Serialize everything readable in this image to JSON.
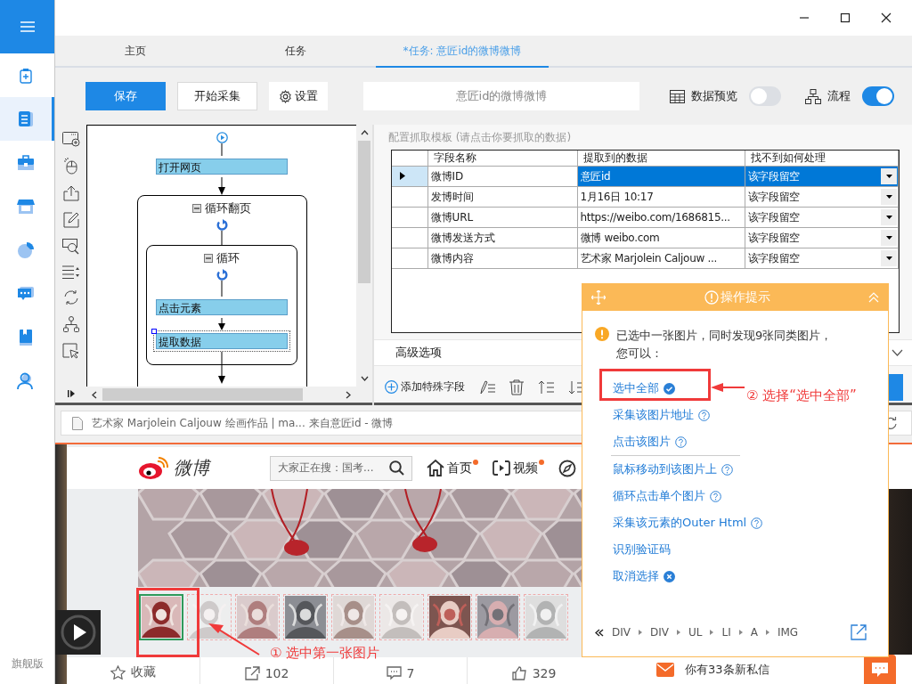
{
  "sidebar": {
    "items": [
      {
        "selected": false
      },
      {
        "selected": true
      },
      {
        "selected": false
      },
      {
        "selected": false
      },
      {
        "selected": false
      },
      {
        "selected": false
      },
      {
        "selected": false
      },
      {
        "selected": false
      }
    ],
    "edition": "旗舰版"
  },
  "tabs": [
    {
      "label": "主页",
      "selected": false
    },
    {
      "label": "任务",
      "selected": false
    },
    {
      "label": "*任务: 意匠id的微博微博",
      "selected": true
    }
  ],
  "toolbar": {
    "save": "保存",
    "start": "开始采集",
    "settings": "设置",
    "task_name": "意匠id的微博微博",
    "preview": {
      "label": "数据预览",
      "on": false
    },
    "flow": {
      "label": "流程",
      "on": true
    }
  },
  "flow": {
    "steps": [
      {
        "kind": "action",
        "label": "打开网页",
        "selected": false
      },
      {
        "kind": "loop",
        "label": "循环翻页",
        "expanded": true,
        "children": [
          {
            "kind": "loop",
            "label": "循环",
            "expanded": true,
            "children": [
              {
                "kind": "action",
                "label": "点击元素",
                "selected": false
              },
              {
                "kind": "action",
                "label": "提取数据",
                "selected": true
              }
            ]
          }
        ]
      }
    ]
  },
  "config": {
    "title": "配置抓取模板 (请点击你要抓取的数据)",
    "columns": [
      "字段名称",
      "提取到的数据",
      "找不到如何处理"
    ],
    "rows": [
      {
        "name": "微博ID",
        "value": "意匠id",
        "fallback": "该字段留空",
        "selected": true
      },
      {
        "name": "发博时间",
        "value": "1月16日 10:17",
        "fallback": "该字段留空",
        "selected": false
      },
      {
        "name": "微博URL",
        "value": "https://weibo.com/1686815...",
        "fallback": "该字段留空",
        "selected": false
      },
      {
        "name": "微博发送方式",
        "value": "微博 weibo.com",
        "fallback": "该字段留空",
        "selected": false
      },
      {
        "name": "微博内容",
        "value": "艺术家 Marjolein Caljouw ...",
        "fallback": "该字段留空",
        "selected": false
      }
    ],
    "advanced": "高级选项",
    "add_field": "添加特殊字段"
  },
  "browser": {
    "page_title": "艺术家 Marjolein Caljouw 绘画作品 | ma... 来自意匠id - 微博",
    "logo": "微博",
    "search_placeholder": "大家正在搜：国考...",
    "nav": [
      {
        "label": "首页",
        "badge": true
      },
      {
        "label": "视频",
        "badge": true
      }
    ],
    "thumbnails": [
      {
        "selected": true
      },
      {
        "selected": false
      },
      {
        "selected": false
      },
      {
        "selected": false
      },
      {
        "selected": false
      },
      {
        "selected": false
      },
      {
        "selected": false
      },
      {
        "selected": false
      },
      {
        "selected": false
      }
    ],
    "actions": [
      {
        "kind": "star",
        "label": "收藏"
      },
      {
        "kind": "share",
        "label": "102"
      },
      {
        "kind": "comment",
        "label": "7"
      },
      {
        "kind": "like",
        "label": "329"
      }
    ],
    "message": "你有33条新私信"
  },
  "tip": {
    "title": "操作提示",
    "message": "已选中一张图片，同时发现9张同类图片，您可以：",
    "options": [
      {
        "label": "选中全部",
        "kind": "check",
        "divider_before": false
      },
      {
        "label": "采集该图片地址",
        "kind": "help",
        "divider_before": false
      },
      {
        "label": "点击该图片",
        "kind": "help",
        "divider_before": false
      },
      {
        "label": "鼠标移动到该图片上",
        "kind": "help",
        "divider_before": true
      },
      {
        "label": "循环点击单个图片",
        "kind": "help",
        "divider_before": false
      },
      {
        "label": "采集该元素的Outer Html",
        "kind": "help",
        "divider_before": false
      },
      {
        "label": "识别验证码",
        "kind": "plain",
        "divider_before": false
      },
      {
        "label": "取消选择",
        "kind": "cancel",
        "divider_before": false
      }
    ],
    "path": [
      "DIV",
      "DIV",
      "UL",
      "LI",
      "A",
      "IMG"
    ]
  },
  "annotations": [
    {
      "kind": "thumbnail",
      "text": "① 选中第一张图片"
    },
    {
      "kind": "option",
      "text": "② 选择“选中全部”"
    }
  ]
}
